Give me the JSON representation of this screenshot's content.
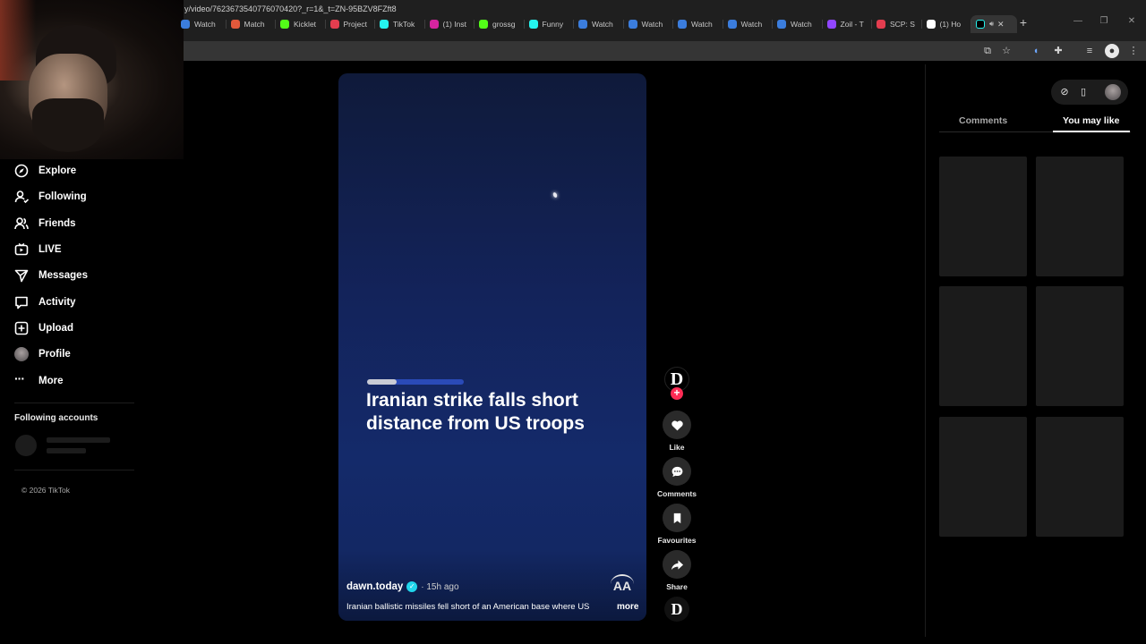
{
  "browser": {
    "tabs": [
      {
        "title": "Watch",
        "icon_color": "#3b7ddd"
      },
      {
        "title": "Match",
        "icon_color": "#e2593b"
      },
      {
        "title": "Kicklet",
        "icon_color": "#53fc18"
      },
      {
        "title": "Project",
        "icon_color": "#e33d4f"
      },
      {
        "title": "TikTok",
        "icon_color": "#25f4ee"
      },
      {
        "title": "(1) Inst",
        "icon_color": "#d6249f"
      },
      {
        "title": "grossg",
        "icon_color": "#53fc18"
      },
      {
        "title": "Funny",
        "icon_color": "#25f4ee"
      },
      {
        "title": "Watch",
        "icon_color": "#3b7ddd"
      },
      {
        "title": "Watch",
        "icon_color": "#3b7ddd"
      },
      {
        "title": "Watch",
        "icon_color": "#3b7ddd"
      },
      {
        "title": "Watch",
        "icon_color": "#3b7ddd"
      },
      {
        "title": "Watch",
        "icon_color": "#3b7ddd"
      },
      {
        "title": "Zoil - T",
        "icon_color": "#9146ff"
      },
      {
        "title": "SCP: S",
        "icon_color": "#e33d4f"
      },
      {
        "title": "(1) Ho",
        "icon_color": "#ffffff"
      }
    ],
    "active_tab": {
      "icon_color": "#25f4ee"
    },
    "url": "y/video/7623673540776070420?_r=1&_t=ZN-95BZV8FZft8"
  },
  "sidebar": {
    "nav": [
      {
        "label": "Explore",
        "icon": "compass-icon"
      },
      {
        "label": "Following",
        "icon": "user-follow-icon"
      },
      {
        "label": "Friends",
        "icon": "friends-icon"
      },
      {
        "label": "LIVE",
        "icon": "live-icon"
      },
      {
        "label": "Messages",
        "icon": "paper-plane-icon"
      },
      {
        "label": "Activity",
        "icon": "message-square-icon"
      },
      {
        "label": "Upload",
        "icon": "upload-plus-icon"
      },
      {
        "label": "Profile",
        "icon": "avatar"
      },
      {
        "label": "More",
        "icon": "dots-icon"
      }
    ],
    "following_title": "Following accounts",
    "copyright": "© 2026 TikTok"
  },
  "video": {
    "headline": "Iranian strike falls short distance from US troops",
    "progress": 0.31,
    "author": "dawn.today",
    "time": "· 15h ago",
    "caption": "Iranian ballistic missiles fell short of an American base where US",
    "more": "more",
    "overlay_logo": "AA"
  },
  "actions": {
    "creator_initial": "D",
    "follow_plus": "+",
    "like": "Like",
    "comments": "Comments",
    "favourites": "Favourites",
    "share": "Share",
    "sound_initial": "D"
  },
  "panel": {
    "tabs": [
      "Comments",
      "You may like"
    ],
    "active_tab": "You may like"
  },
  "colors": {
    "accent": "#fe2c55",
    "verified": "#20d5ec",
    "video_bg": "#13235a"
  }
}
